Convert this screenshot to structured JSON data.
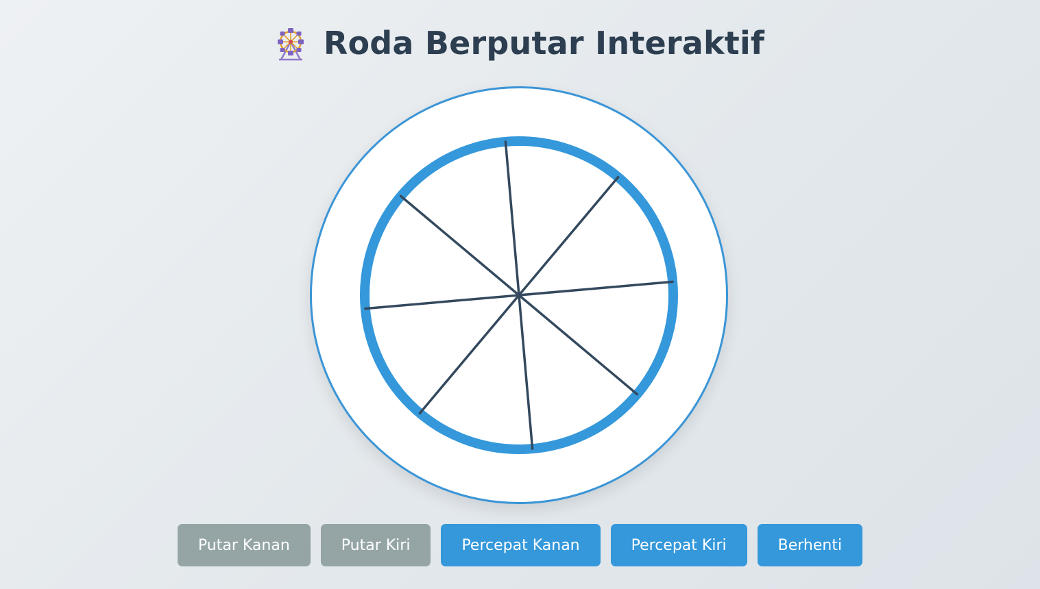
{
  "page": {
    "title": "Roda Berputar Interaktif",
    "title_icon": "ferris-wheel-icon"
  },
  "wheel": {
    "rim_color": "#3498db",
    "spoke_color": "#34495e",
    "frame_border_color": "#3b95d6",
    "spoke_count": 8,
    "rotation_deg": -5
  },
  "controls": {
    "rotate_right": "Putar Kanan",
    "rotate_left": "Putar Kiri",
    "speed_right": "Percepat Kanan",
    "speed_left": "Percepat Kiri",
    "stop": "Berhenti"
  },
  "colors": {
    "title": "#2c3e50",
    "button_inactive": "#95a5a6",
    "button_active": "#3498db"
  }
}
